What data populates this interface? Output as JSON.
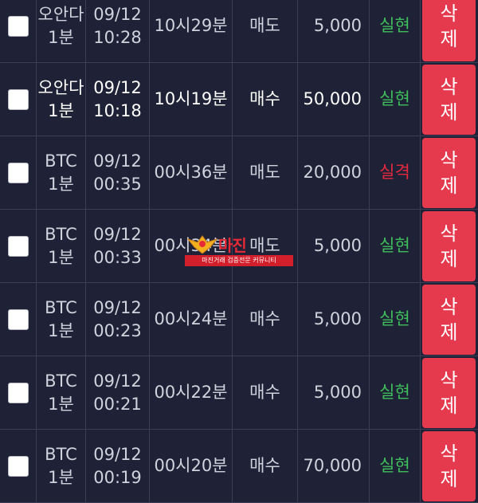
{
  "colors": {
    "background": "#1f2236",
    "result_win": "#3fbf5a",
    "result_lose": "#e5283f",
    "delete_button": "#e53a4e"
  },
  "rows": [
    {
      "name": "오안다",
      "period": "1분",
      "date": "09/12",
      "time": "10:28",
      "start_time": "10시29분",
      "type": "매도",
      "amount": "5,000",
      "result": "실현",
      "result_status": "win",
      "action": "삭제"
    },
    {
      "name": "오안다",
      "period": "1분",
      "date": "09/12",
      "time": "10:18",
      "start_time": "10시19분",
      "type": "매수",
      "amount": "50,000",
      "result": "실현",
      "result_status": "win",
      "action": "삭제"
    },
    {
      "name": "BTC",
      "period": "1분",
      "date": "09/12",
      "time": "00:35",
      "start_time": "00시36분",
      "type": "매도",
      "amount": "20,000",
      "result": "실격",
      "result_status": "lose",
      "action": "삭제"
    },
    {
      "name": "BTC",
      "period": "1분",
      "date": "09/12",
      "time": "00:33",
      "start_time": "00시34분",
      "type": "매도",
      "amount": "5,000",
      "result": "실현",
      "result_status": "win",
      "action": "삭제"
    },
    {
      "name": "BTC",
      "period": "1분",
      "date": "09/12",
      "time": "00:23",
      "start_time": "00시24분",
      "type": "매수",
      "amount": "5,000",
      "result": "실현",
      "result_status": "win",
      "action": "삭제"
    },
    {
      "name": "BTC",
      "period": "1분",
      "date": "09/12",
      "time": "00:21",
      "start_time": "00시22분",
      "type": "매수",
      "amount": "5,000",
      "result": "실현",
      "result_status": "win",
      "action": "삭제"
    },
    {
      "name": "BTC",
      "period": "1분",
      "date": "09/12",
      "time": "00:19",
      "start_time": "00시20분",
      "type": "매수",
      "amount": "70,000",
      "result": "실현",
      "result_status": "win",
      "action": "삭제"
    }
  ],
  "watermark": {
    "logo_text": "마진",
    "tagline": "마진거래 검증전문 커뮤니티"
  }
}
